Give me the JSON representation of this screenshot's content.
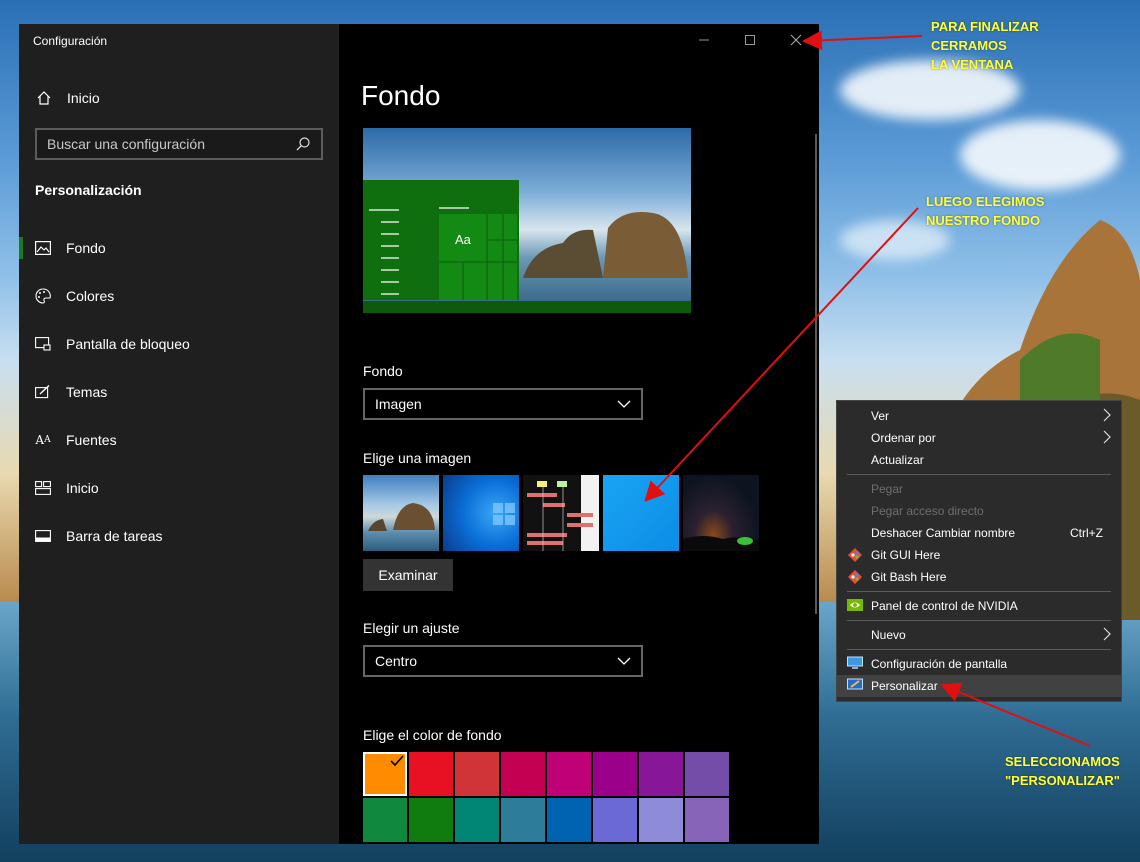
{
  "window": {
    "title": "Configuración",
    "controls": [
      "minimize",
      "maximize",
      "close"
    ]
  },
  "sidebar": {
    "home_label": "Inicio",
    "search_placeholder": "Buscar una configuración",
    "section_title": "Personalización",
    "items": [
      {
        "label": "Fondo",
        "icon": "picture-icon",
        "active": true
      },
      {
        "label": "Colores",
        "icon": "palette-icon"
      },
      {
        "label": "Pantalla de bloqueo",
        "icon": "lock-screen-icon"
      },
      {
        "label": "Temas",
        "icon": "brush-icon"
      },
      {
        "label": "Fuentes",
        "icon": "font-icon"
      },
      {
        "label": "Inicio",
        "icon": "start-icon"
      },
      {
        "label": "Barra de tareas",
        "icon": "taskbar-icon"
      }
    ]
  },
  "main": {
    "title": "Fondo",
    "preview_sample_text": "Aa",
    "background_label": "Fondo",
    "background_value": "Imagen",
    "choose_image_label": "Elige una imagen",
    "browse_button": "Examinar",
    "fit_label": "Elegir un ajuste",
    "fit_value": "Centro",
    "color_label": "Elige el color de fondo",
    "colors": [
      "#ff8c00",
      "#e81123",
      "#d13438",
      "#c30052",
      "#bf0077",
      "#9a0089",
      "#881798",
      "#744da9",
      "#10893e",
      "#107c10",
      "#018574",
      "#2d7d9a",
      "#0063b1",
      "#6b69d6",
      "#8e8cd8",
      "#8764b8"
    ],
    "selected_color_index": 0
  },
  "context_menu": {
    "items": [
      {
        "label": "Ver",
        "submenu": true
      },
      {
        "label": "Ordenar por",
        "submenu": true
      },
      {
        "label": "Actualizar"
      },
      {
        "separator": true
      },
      {
        "label": "Pegar",
        "disabled": true
      },
      {
        "label": "Pegar acceso directo",
        "disabled": true
      },
      {
        "label": "Deshacer Cambiar nombre",
        "shortcut": "Ctrl+Z"
      },
      {
        "label": "Git GUI Here",
        "icon": "git-icon"
      },
      {
        "label": "Git Bash Here",
        "icon": "git-icon"
      },
      {
        "separator": true
      },
      {
        "label": "Panel de control de NVIDIA",
        "icon": "nvidia-icon"
      },
      {
        "separator": true
      },
      {
        "label": "Nuevo",
        "submenu": true
      },
      {
        "separator": true
      },
      {
        "label": "Configuración de pantalla",
        "icon": "display-icon"
      },
      {
        "label": "Personalizar",
        "icon": "personalize-icon",
        "hover": true
      }
    ]
  },
  "annotations": {
    "close_note": [
      "PARA FINALIZAR",
      "CERRAMOS",
      "LA VENTANA"
    ],
    "background_note": [
      "LUEGO ELEGIMOS",
      "NUESTRO FONDO"
    ],
    "personalize_note": [
      "SELECCIONAMOS",
      "\"PERSONALIZAR\""
    ],
    "arrow_color": "#e01010"
  }
}
